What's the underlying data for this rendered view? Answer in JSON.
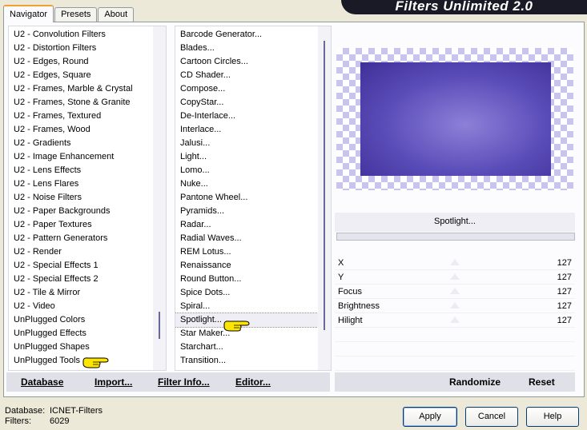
{
  "tabs": [
    "Navigator",
    "Presets",
    "About"
  ],
  "banner": "Filters Unlimited 2.0",
  "categories": [
    "U2 - Convolution Filters",
    "U2 - Distortion Filters",
    "U2 - Edges, Round",
    "U2 - Edges, Square",
    "U2 - Frames, Marble & Crystal",
    "U2 - Frames, Stone & Granite",
    "U2 - Frames, Textured",
    "U2 - Frames, Wood",
    "U2 - Gradients",
    "U2 - Image Enhancement",
    "U2 - Lens Effects",
    "U2 - Lens Flares",
    "U2 - Noise Filters",
    "U2 - Paper Backgrounds",
    "U2 - Paper Textures",
    "U2 - Pattern Generators",
    "U2 - Render",
    "U2 - Special Effects 1",
    "U2 - Special Effects 2",
    "U2 - Tile & Mirror",
    "U2 - Video",
    "UnPlugged Colors",
    "UnPlugged Effects",
    "UnPlugged Shapes",
    "UnPlugged Tools"
  ],
  "filters": [
    "Barcode Generator...",
    "Blades...",
    "Cartoon Circles...",
    "CD Shader...",
    "Compose...",
    "CopyStar...",
    "De-Interlace...",
    "Interlace...",
    "Jalusi...",
    "Light...",
    "Lomo...",
    "Nuke...",
    "Pantone Wheel...",
    "Pyramids...",
    "Radar...",
    "Radial Waves...",
    "REM Lotus...",
    "Renaissance",
    "Round Button...",
    "Spice Dots...",
    "Spiral...",
    "Spotlight...",
    "Star Maker...",
    "Starchart...",
    "Transition..."
  ],
  "selected_filter": "Spotlight...",
  "sliders": [
    {
      "label": "X",
      "value": "127"
    },
    {
      "label": "Y",
      "value": "127"
    },
    {
      "label": "Focus",
      "value": "127"
    },
    {
      "label": "Brightness",
      "value": "127"
    },
    {
      "label": "Hilight",
      "value": "127"
    }
  ],
  "toolbar": {
    "database": "Database",
    "import": "Import...",
    "filter_info": "Filter Info...",
    "editor": "Editor...",
    "randomize": "Randomize",
    "reset": "Reset"
  },
  "footer": {
    "database_label": "Database:",
    "database_value": "ICNET-Filters",
    "filters_label": "Filters:",
    "filters_value": "6029"
  },
  "buttons": {
    "apply": "Apply",
    "cancel": "Cancel",
    "help": "Help"
  },
  "colors": {
    "preview_fill": "#5a4cb8",
    "checker": "#c8c4ec"
  }
}
